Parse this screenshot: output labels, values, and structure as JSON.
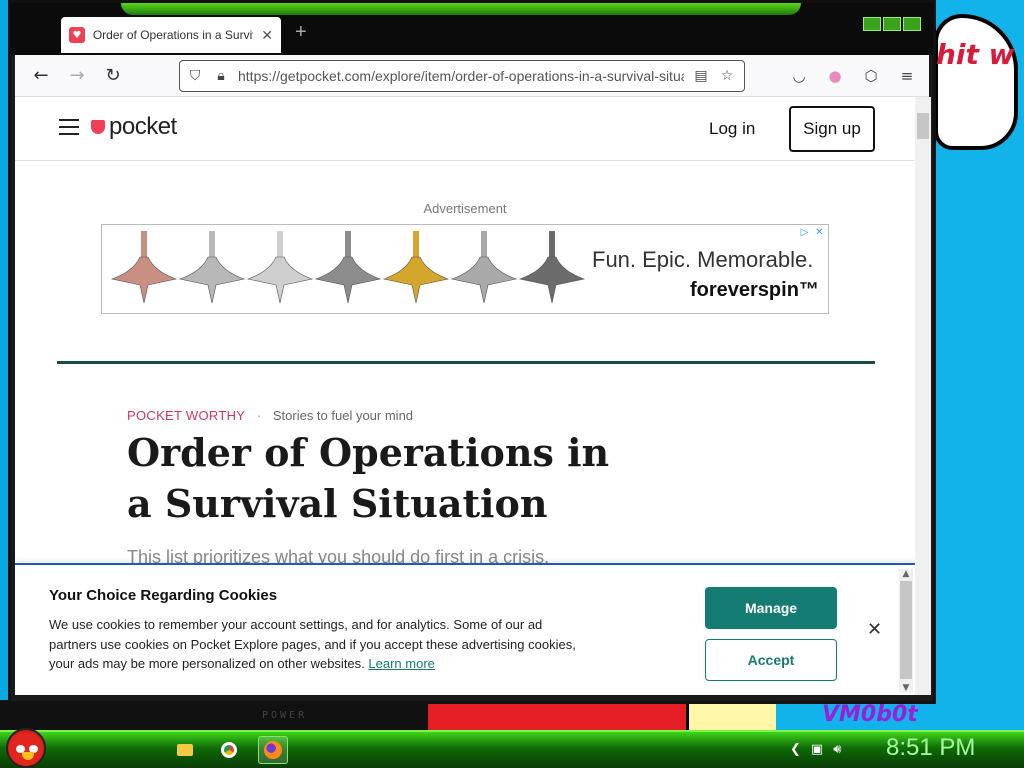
{
  "desktop": {
    "speech_text": "hit w",
    "power_label": "POWER",
    "vm_label": "VM0b0t"
  },
  "browser": {
    "tab": {
      "title": "Order of Operations in a Survival Situation",
      "close": "✕"
    },
    "new_tab": "+",
    "url": "https://getpocket.com/explore/item/order-of-operations-in-a-survival-situation"
  },
  "site": {
    "logo": "pocket",
    "login": "Log in",
    "signup": "Sign up"
  },
  "ad": {
    "label": "Advertisement",
    "tagline": "Fun. Epic. Memorable.",
    "brand": "foreverspin™",
    "top_colors": [
      "#c98f82",
      "#b8b8b8",
      "#cfcfcf",
      "#8c8c8c",
      "#d4a72c",
      "#a9a9a9",
      "#6b6b6b"
    ]
  },
  "article": {
    "kicker_brand": "POCKET WORTHY",
    "kicker_sep": "·",
    "kicker_sub": "Stories to fuel your mind",
    "title": "Order of Operations in a Survival Situation",
    "dek": "This list prioritizes what you should do first in a crisis."
  },
  "cookie": {
    "title": "Your Choice Regarding Cookies",
    "body": "We use cookies to remember your account settings, and for analytics. Some of our ad partners use cookies on Pocket Explore pages, and if you accept these advertising cookies, your ads may be more personalized on other websites.",
    "link": "Learn more",
    "manage": "Manage",
    "accept": "Accept",
    "close": "✕"
  },
  "taskbar": {
    "clock": "8:51 PM"
  },
  "colors": {
    "pocket_red": "#ef4056",
    "cookie_teal": "#147c72",
    "divider": "#1a4b47"
  }
}
